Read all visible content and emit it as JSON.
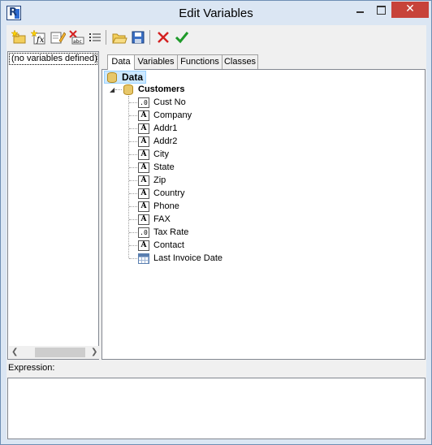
{
  "window": {
    "title": "Edit Variables"
  },
  "titlebar_buttons": {
    "close_glyph": "✕"
  },
  "toolbar": {
    "buttons": [
      {
        "icon": "new-category-icon"
      },
      {
        "icon": "new-variable-icon"
      },
      {
        "icon": "edit-icon"
      },
      {
        "icon": "delete-icon"
      },
      {
        "icon": "list-icon"
      },
      {
        "icon": "open-folder-icon"
      },
      {
        "icon": "save-icon"
      },
      {
        "icon": "cancel-icon",
        "color": "#d42020"
      },
      {
        "icon": "ok-icon",
        "color": "#1f9a2a"
      }
    ]
  },
  "left_panel": {
    "items": [
      "(no variables defined)"
    ]
  },
  "tabs": [
    {
      "label": "Data",
      "active": true
    },
    {
      "label": "Variables",
      "active": false
    },
    {
      "label": "Functions",
      "active": false
    },
    {
      "label": "Classes",
      "active": false
    }
  ],
  "tree": {
    "root": "Data",
    "table": "Customers",
    "fields": [
      {
        "name": "Cust No",
        "type": "number"
      },
      {
        "name": "Company",
        "type": "text"
      },
      {
        "name": "Addr1",
        "type": "text"
      },
      {
        "name": "Addr2",
        "type": "text"
      },
      {
        "name": "City",
        "type": "text"
      },
      {
        "name": "State",
        "type": "text"
      },
      {
        "name": "Zip",
        "type": "text"
      },
      {
        "name": "Country",
        "type": "text"
      },
      {
        "name": "Phone",
        "type": "text"
      },
      {
        "name": "FAX",
        "type": "text"
      },
      {
        "name": "Tax Rate",
        "type": "number"
      },
      {
        "name": "Contact",
        "type": "text"
      },
      {
        "name": "Last Invoice Date",
        "type": "date"
      }
    ],
    "type_glyphs": {
      "number": ".0",
      "text": "A",
      "date": ""
    }
  },
  "expression": {
    "label": "Expression:",
    "value": ""
  },
  "colors": {
    "titlebar": "#dbe6f3",
    "close_button": "#c7433a",
    "selection": "#cce8ff"
  }
}
